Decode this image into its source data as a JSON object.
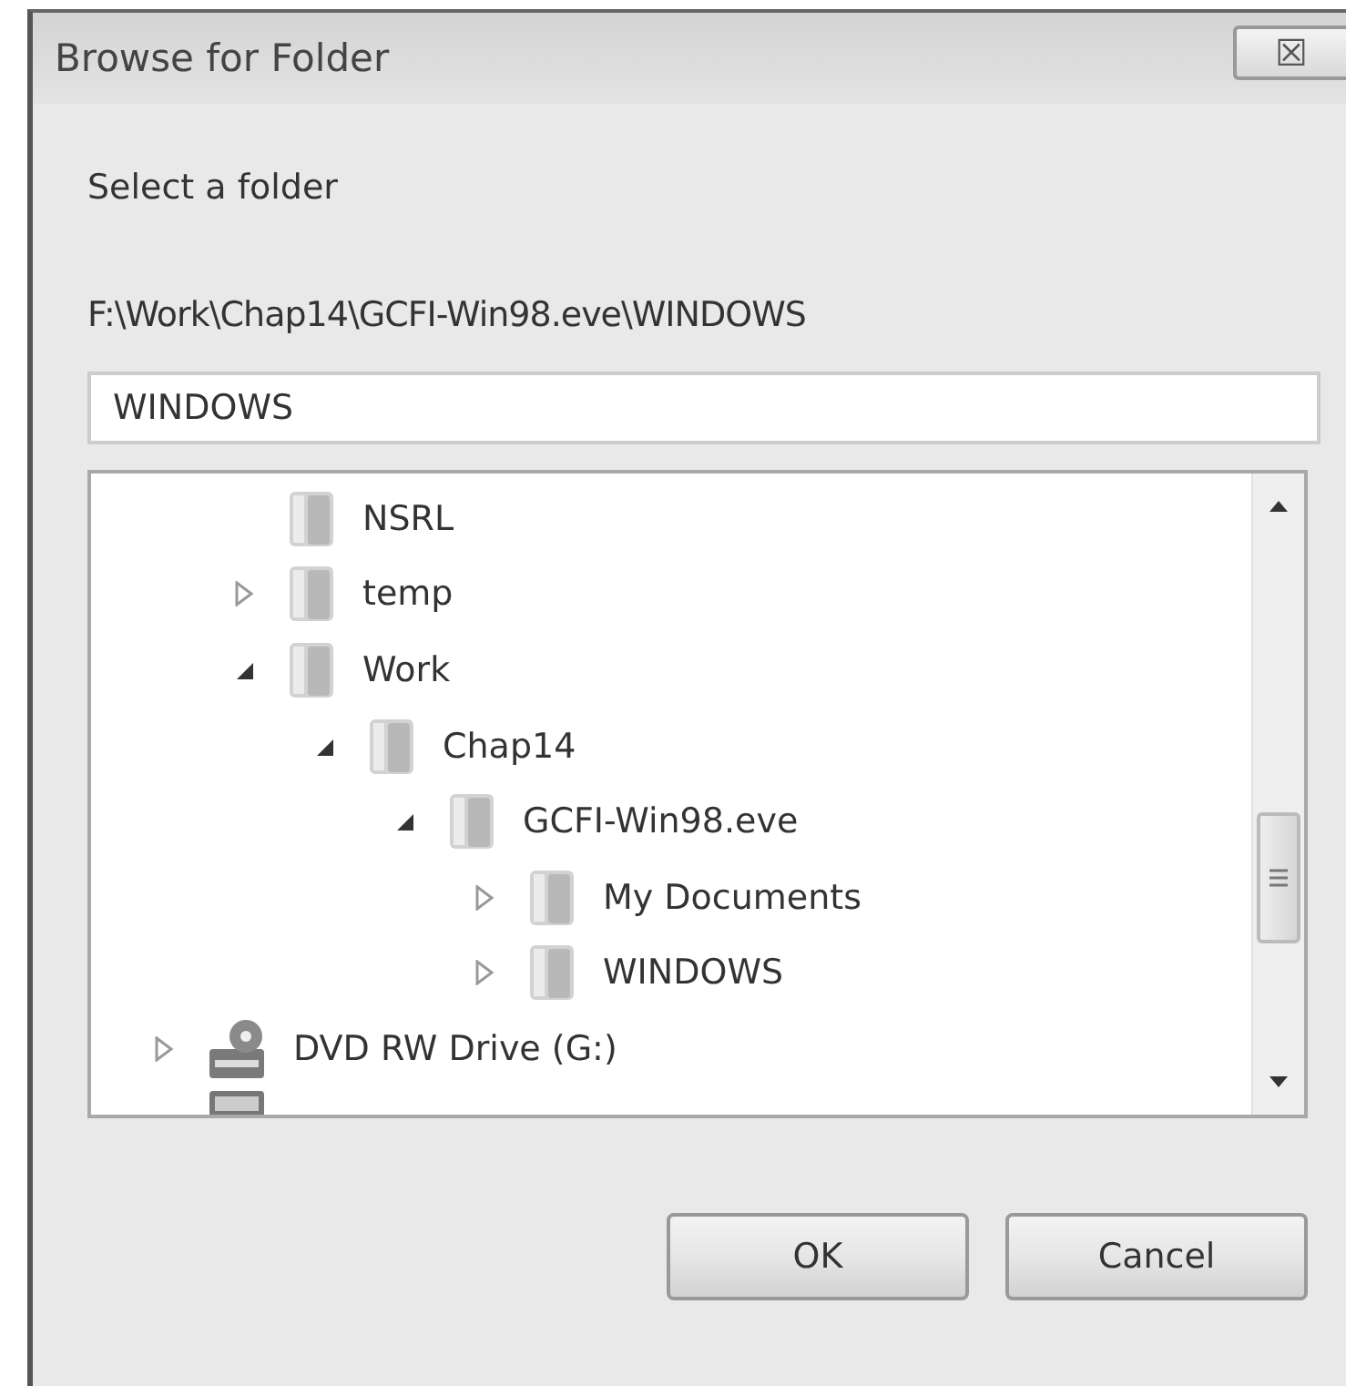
{
  "window": {
    "title": "Browse for Folder",
    "close": "☒"
  },
  "prompt": "Select a folder",
  "path": "F:\\Work\\Chap14\\GCFI-Win98.eve\\WINDOWS",
  "folder_field": {
    "value": "WINDOWS"
  },
  "tree": {
    "items": [
      {
        "kind": "hidden",
        "children": [
          {
            "kind": "folder",
            "label": "NSRL",
            "expandable": false
          },
          {
            "kind": "folder",
            "label": "temp",
            "expandable": true,
            "expanded": false
          },
          {
            "kind": "folder",
            "label": "Work",
            "expandable": true,
            "expanded": true,
            "children": [
              {
                "kind": "folder",
                "label": "Chap14",
                "expandable": true,
                "expanded": true,
                "children": [
                  {
                    "kind": "folder",
                    "label": "GCFI-Win98.eve",
                    "expandable": true,
                    "expanded": true,
                    "children": [
                      {
                        "kind": "folder",
                        "label": "My Documents",
                        "expandable": true,
                        "expanded": false
                      },
                      {
                        "kind": "folder",
                        "label": "WINDOWS",
                        "expandable": true,
                        "expanded": false
                      }
                    ]
                  }
                ]
              }
            ]
          }
        ]
      },
      {
        "kind": "dvd",
        "label": "DVD RW Drive (G:)",
        "expandable": true,
        "expanded": false
      },
      {
        "kind": "drive"
      }
    ]
  },
  "buttons": [
    "OK",
    "Cancel"
  ]
}
